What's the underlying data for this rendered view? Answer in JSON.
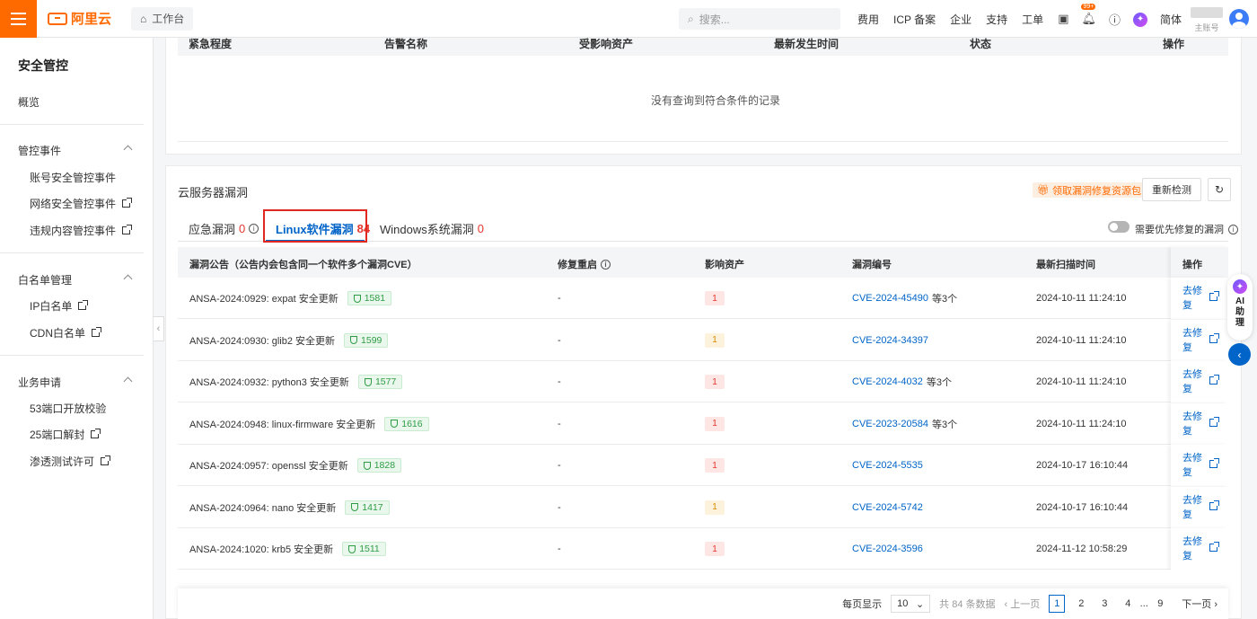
{
  "header": {
    "brand": "阿里云",
    "workbench": "工作台",
    "search_placeholder": "搜索...",
    "links": [
      "费用",
      "ICP 备案",
      "企业",
      "支持",
      "工单"
    ],
    "notification_badge": "99+",
    "language": "简体",
    "account_sub": "主账号"
  },
  "sidebar": {
    "title": "安全管控",
    "overview": "概览",
    "groups": [
      {
        "label": "管控事件",
        "items": [
          "账号安全管控事件",
          "网络安全管控事件",
          "违规内容管控事件"
        ]
      },
      {
        "label": "白名单管理",
        "items": [
          "IP白名单",
          "CDN白名单"
        ]
      },
      {
        "label": "业务申请",
        "items": [
          "53端口开放校验",
          "25端口解封",
          "渗透测试许可"
        ]
      }
    ]
  },
  "alert_table": {
    "columns": [
      "紧急程度",
      "告警名称",
      "受影响资产",
      "最新发生时间",
      "状态",
      "操作"
    ],
    "empty_text": "没有查询到符合条件的记录"
  },
  "vuln": {
    "title": "云服务器漏洞",
    "promo": "领取漏洞修复资源包",
    "recheck": "重新检测",
    "tabs": [
      {
        "label": "应急漏洞",
        "count": "0"
      },
      {
        "label": "Linux软件漏洞",
        "count": "84"
      },
      {
        "label": "Windows系统漏洞",
        "count": "0"
      }
    ],
    "toggle_label": "需要优先修复的漏洞",
    "columns": [
      "漏洞公告（公告内会包含同一个软件多个漏洞CVE）",
      "修复重启",
      "影响资产",
      "漏洞编号",
      "最新扫描时间",
      "操作"
    ],
    "rows": [
      {
        "notice": "ANSA-2024:0929: expat 安全更新",
        "tag": "1581",
        "restart": "-",
        "assets": "1",
        "level": "high",
        "cve": "CVE-2024-45490",
        "more": "等3个",
        "time": "2024-10-11 11:24:10",
        "action": "去修复"
      },
      {
        "notice": "ANSA-2024:0930: glib2 安全更新",
        "tag": "1599",
        "restart": "-",
        "assets": "1",
        "level": "medium",
        "cve": "CVE-2024-34397",
        "more": "",
        "time": "2024-10-11 11:24:10",
        "action": "去修复"
      },
      {
        "notice": "ANSA-2024:0932: python3 安全更新",
        "tag": "1577",
        "restart": "-",
        "assets": "1",
        "level": "high",
        "cve": "CVE-2024-4032",
        "more": "等3个",
        "time": "2024-10-11 11:24:10",
        "action": "去修复"
      },
      {
        "notice": "ANSA-2024:0948: linux-firmware 安全更新",
        "tag": "1616",
        "restart": "-",
        "assets": "1",
        "level": "high",
        "cve": "CVE-2023-20584",
        "more": "等3个",
        "time": "2024-10-11 11:24:10",
        "action": "去修复"
      },
      {
        "notice": "ANSA-2024:0957: openssl 安全更新",
        "tag": "1828",
        "restart": "-",
        "assets": "1",
        "level": "high",
        "cve": "CVE-2024-5535",
        "more": "",
        "time": "2024-10-17 16:10:44",
        "action": "去修复"
      },
      {
        "notice": "ANSA-2024:0964: nano 安全更新",
        "tag": "1417",
        "restart": "-",
        "assets": "1",
        "level": "medium",
        "cve": "CVE-2024-5742",
        "more": "",
        "time": "2024-10-17 16:10:44",
        "action": "去修复"
      },
      {
        "notice": "ANSA-2024:1020: krb5 安全更新",
        "tag": "1511",
        "restart": "-",
        "assets": "1",
        "level": "high",
        "cve": "CVE-2024-3596",
        "more": "",
        "time": "2024-11-12 10:58:29",
        "action": "去修复"
      }
    ],
    "pagination": {
      "per_page_label": "每页显示",
      "page_size": "10",
      "total": "共 84 条数据",
      "prev": "上一页",
      "pages": [
        "1",
        "2",
        "3",
        "4",
        "...",
        "9"
      ],
      "next": "下一页"
    }
  },
  "ai_assistant": "AI助理",
  "colors": {
    "brand": "#ff6a00",
    "link": "#0064c8",
    "danger": "#e5362e"
  }
}
